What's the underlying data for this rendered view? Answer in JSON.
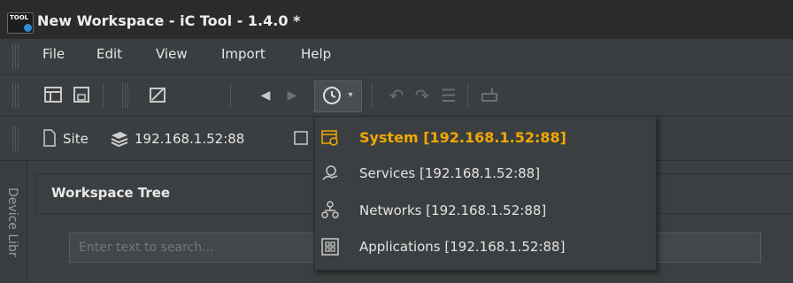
{
  "window": {
    "title": "New Workspace - iC Tool - 1.4.0 *",
    "logo_text": "TOOL"
  },
  "menu": {
    "items": [
      "File",
      "Edit",
      "View",
      "Import",
      "Help"
    ]
  },
  "toolbar": {
    "icons": [
      "layout-icon",
      "save-icon",
      "edit-icon",
      "back-icon",
      "forward-icon",
      "history-icon",
      "undo-icon",
      "redo-icon",
      "list-icon",
      "device-icon"
    ]
  },
  "sitebar": {
    "site_label": "Site",
    "device_label": "192.168.1.52:88"
  },
  "side_tab": {
    "label": "Device Libr"
  },
  "workspace": {
    "title": "Workspace Tree",
    "search_placeholder": "Enter text to search..."
  },
  "dropdown": {
    "items": [
      {
        "label": "System [192.168.1.52:88]",
        "icon": "system-icon",
        "active": true
      },
      {
        "label": "Services [192.168.1.52:88]",
        "icon": "services-icon",
        "active": false
      },
      {
        "label": "Networks [192.168.1.52:88]",
        "icon": "networks-icon",
        "active": false
      },
      {
        "label": "Applications [192.168.1.52:88]",
        "icon": "applications-icon",
        "active": false
      }
    ]
  },
  "colors": {
    "accent": "#f2a800",
    "background": "#3c3f41",
    "titlebar": "#2b2b2b"
  }
}
